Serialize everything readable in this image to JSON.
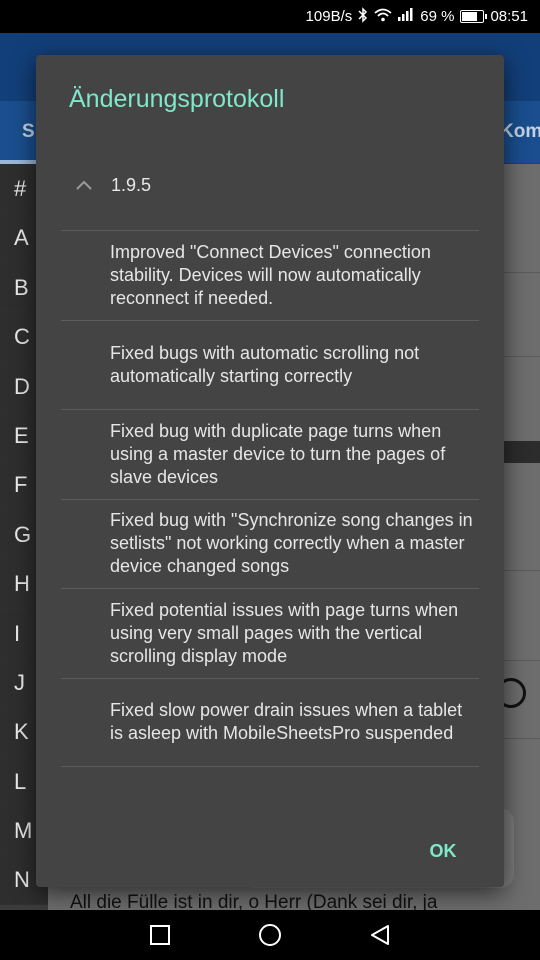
{
  "status_bar": {
    "net_speed": "109B/s",
    "battery": "69 %",
    "time": "08:51",
    "icons": [
      "bluetooth-icon",
      "wifi-icon",
      "signal-icon",
      "battery-icon"
    ]
  },
  "background": {
    "tabs": [
      "S",
      "Kom"
    ],
    "index_letters": [
      "#",
      "A",
      "B",
      "C",
      "D",
      "E",
      "F",
      "G",
      "H",
      "I",
      "J",
      "K",
      "L",
      "M",
      "N"
    ],
    "bottom_text": "All die Fülle ist in dir, o Herr (Dank sei dir, ja"
  },
  "dialog": {
    "title": "Änderungsprotokoll",
    "version": "1.9.5",
    "items": [
      "Improved \"Connect Devices\" connection stability. Devices will now automatically reconnect if needed.",
      "Fixed bugs with automatic scrolling not automatically starting correctly",
      "Fixed bug with duplicate page turns when using a master device to turn the pages of slave devices",
      "Fixed bug with \"Synchronize song changes in setlists\" not working correctly when a master device changed songs",
      "Fixed potential issues with page turns when using very small pages with the vertical scrolling display mode",
      "Fixed slow power drain issues when a tablet is asleep with MobileSheetsPro suspended"
    ],
    "ok_label": "OK"
  },
  "colors": {
    "accent": "#7fe8c8",
    "dialog_bg": "#444444",
    "appbar": "#123f79"
  }
}
